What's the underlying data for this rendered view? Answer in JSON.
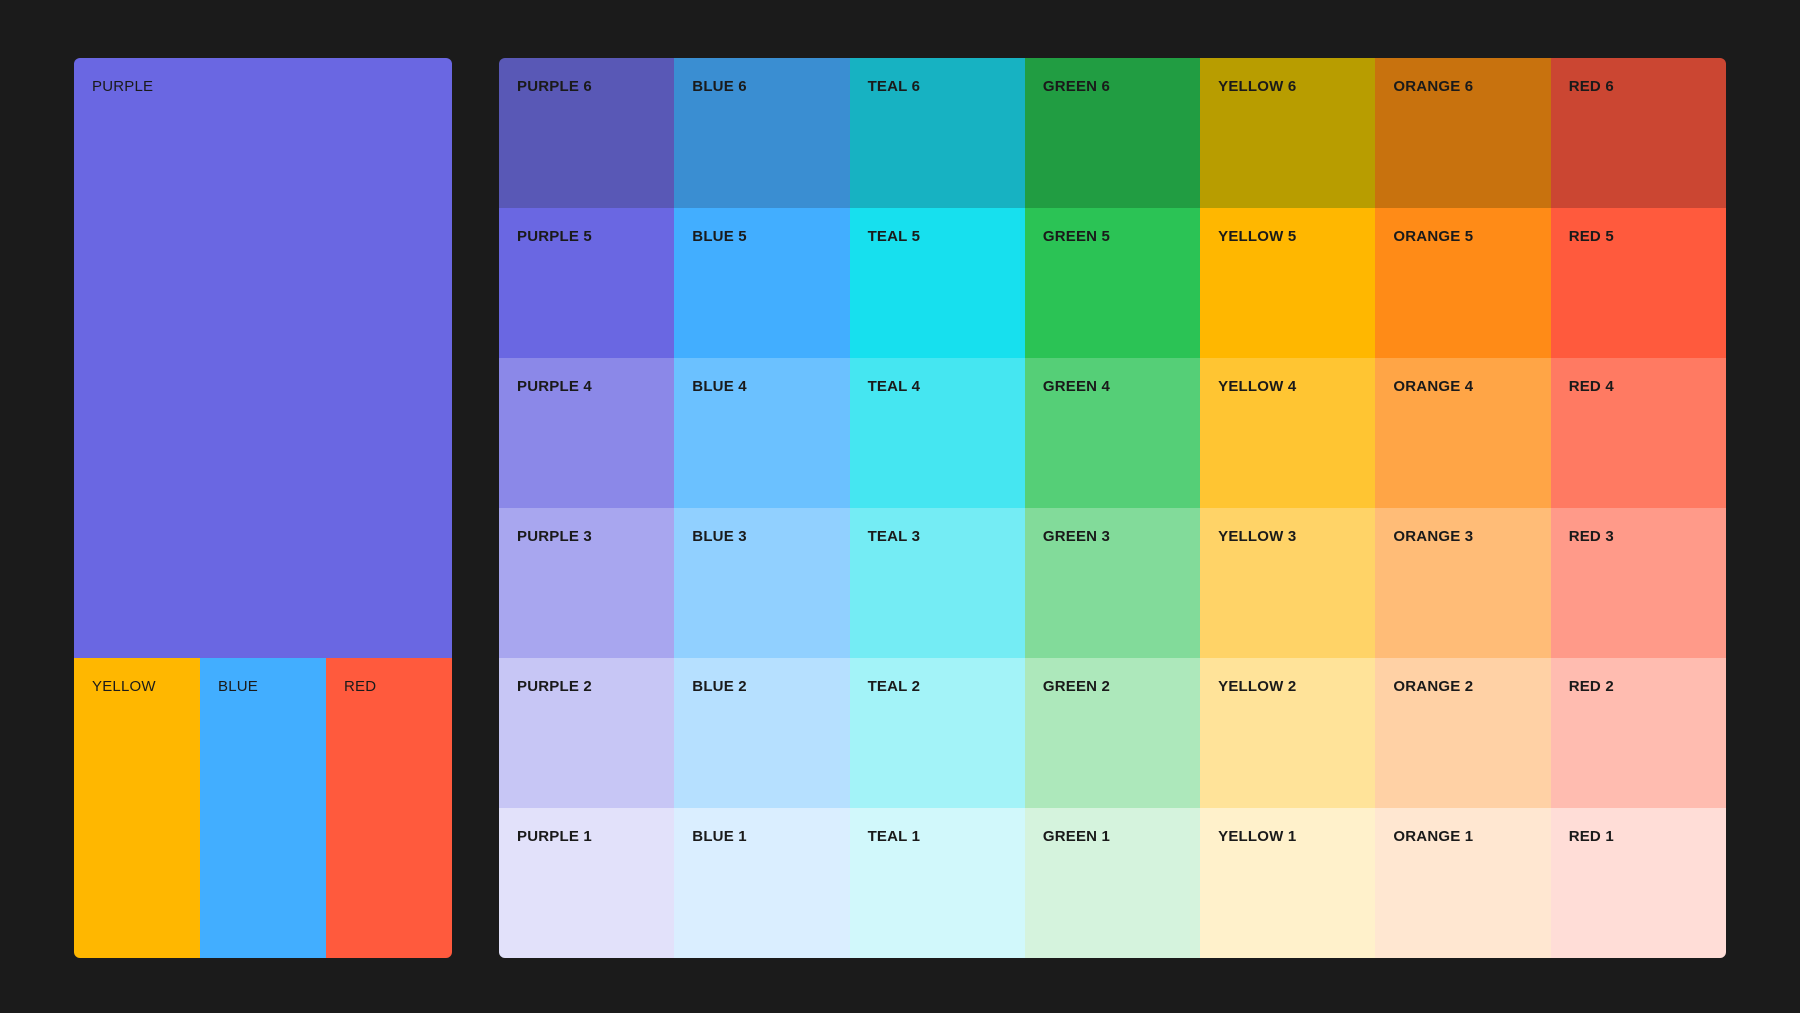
{
  "left_panel": {
    "primary": {
      "label": "PURPLE",
      "color": "#6A67E2"
    },
    "accents": [
      {
        "label": "YELLOW",
        "color": "#FFB700"
      },
      {
        "label": "BLUE",
        "color": "#42AEFF"
      },
      {
        "label": "RED",
        "color": "#FF5A3D"
      }
    ]
  },
  "palette": {
    "rows": [
      [
        {
          "label": "PURPLE 6",
          "color": "#5958B6"
        },
        {
          "label": "BLUE 6",
          "color": "#3A8ED2"
        },
        {
          "label": "TEAL 6",
          "color": "#17B2C2"
        },
        {
          "label": "GREEN 6",
          "color": "#219D42"
        },
        {
          "label": "YELLOW 6",
          "color": "#B89D00"
        },
        {
          "label": "ORANGE 6",
          "color": "#C8720E"
        },
        {
          "label": "RED 6",
          "color": "#CB4632"
        }
      ],
      [
        {
          "label": "PURPLE 5",
          "color": "#6A67E2"
        },
        {
          "label": "BLUE 5",
          "color": "#42AEFF"
        },
        {
          "label": "TEAL 5",
          "color": "#17E0EE"
        },
        {
          "label": "GREEN 5",
          "color": "#2BC355"
        },
        {
          "label": "YELLOW 5",
          "color": "#FFB700"
        },
        {
          "label": "ORANGE 5",
          "color": "#FF8B17"
        },
        {
          "label": "RED 5",
          "color": "#FF5A3D"
        }
      ],
      [
        {
          "label": "PURPLE 4",
          "color": "#8B88E8"
        },
        {
          "label": "BLUE 4",
          "color": "#6BC1FF"
        },
        {
          "label": "TEAL 4",
          "color": "#45E6F1"
        },
        {
          "label": "GREEN 4",
          "color": "#55CF77"
        },
        {
          "label": "YELLOW 4",
          "color": "#FFC532"
        },
        {
          "label": "ORANGE 4",
          "color": "#FFA546"
        },
        {
          "label": "RED 4",
          "color": "#FF7A62"
        }
      ],
      [
        {
          "label": "PURPLE 3",
          "color": "#A8A6EF"
        },
        {
          "label": "BLUE 3",
          "color": "#91D0FF"
        },
        {
          "label": "TEAL 3",
          "color": "#74ECF4"
        },
        {
          "label": "GREEN 3",
          "color": "#82DB9A"
        },
        {
          "label": "YELLOW 3",
          "color": "#FFD367"
        },
        {
          "label": "ORANGE 3",
          "color": "#FFBC77"
        },
        {
          "label": "RED 3",
          "color": "#FF9A89"
        }
      ],
      [
        {
          "label": "PURPLE 2",
          "color": "#C7C6F5"
        },
        {
          "label": "BLUE 2",
          "color": "#B6E0FF"
        },
        {
          "label": "TEAL 2",
          "color": "#A3F3F8"
        },
        {
          "label": "GREEN 2",
          "color": "#ADE8BB"
        },
        {
          "label": "YELLOW 2",
          "color": "#FFE399"
        },
        {
          "label": "ORANGE 2",
          "color": "#FFD1A5"
        },
        {
          "label": "RED 2",
          "color": "#FFBCB0"
        }
      ],
      [
        {
          "label": "PURPLE 1",
          "color": "#E2E1FA"
        },
        {
          "label": "BLUE 1",
          "color": "#DAEEFF"
        },
        {
          "label": "TEAL 1",
          "color": "#D1F8FB"
        },
        {
          "label": "GREEN 1",
          "color": "#D5F3DD"
        },
        {
          "label": "YELLOW 1",
          "color": "#FFF1CB"
        },
        {
          "label": "ORANGE 1",
          "color": "#FFE7D1"
        },
        {
          "label": "RED 1",
          "color": "#FFDDD7"
        }
      ]
    ]
  }
}
